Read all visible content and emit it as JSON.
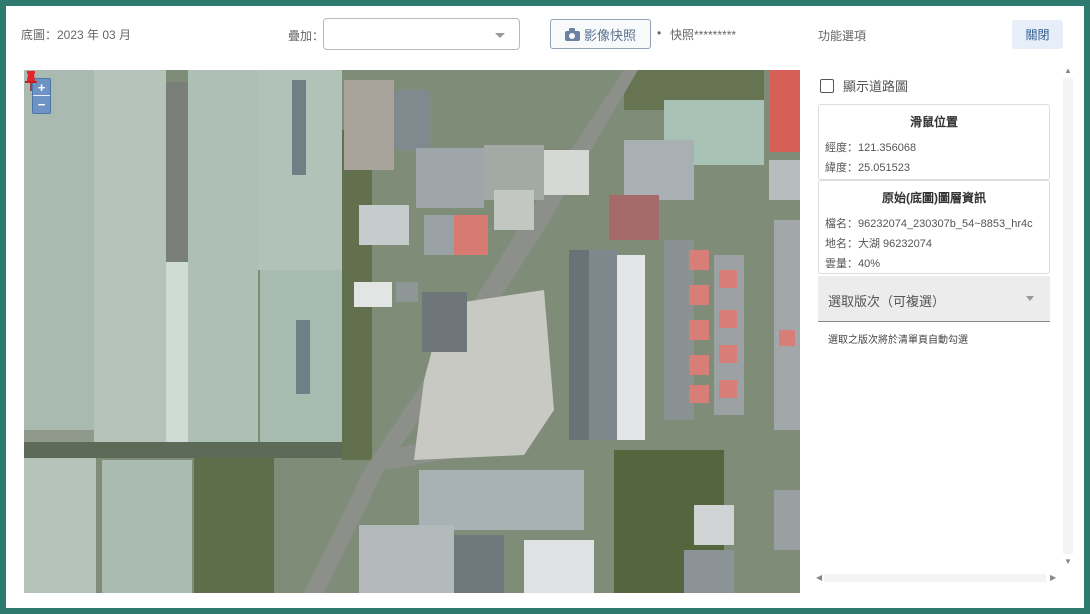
{
  "topbar": {
    "base_map_label": "底圖：2023 年 03 月",
    "overlay_label": "疊加：",
    "overlay_value": "",
    "snapshot_button": "影像快照",
    "snapshot_bullet": "•",
    "snapshot_text": "快照*********",
    "functions_label": "功能選項",
    "close_button": "關閉"
  },
  "map": {
    "zoom_in": "+",
    "zoom_out": "−"
  },
  "panel": {
    "show_roads_label": "顯示道路圖",
    "show_roads_checked": false,
    "mouse_position": {
      "title": "滑鼠位置",
      "longitude": "經度：121.356068",
      "latitude": "緯度：25.051523"
    },
    "layer_info": {
      "title": "原始(底圖)圖層資訊",
      "filename": "檔名：96232074_230307b_54~8853_hr4c",
      "place": "地名：大湖 96232074",
      "cloud": "雲量：40%"
    },
    "version_select_label": "選取版次（可複選）",
    "version_hint": "選取之版次將於清單頁自動勾選"
  },
  "scroll": {
    "up": "▲",
    "down": "▼",
    "left": "◀",
    "right": "▶"
  },
  "colors": {
    "frame_border": "#2f7a6e",
    "accent_button": "#5c7390",
    "pin": "#e0262b"
  }
}
